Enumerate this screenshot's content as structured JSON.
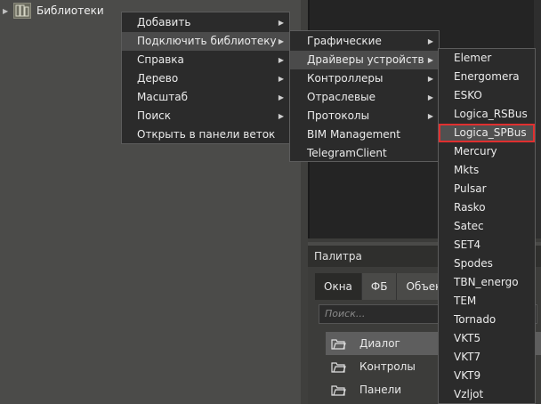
{
  "tree": {
    "root_label": "Библиотеки"
  },
  "palette": {
    "title": "Палитра",
    "tabs": [
      "Окна",
      "ФБ",
      "Объек"
    ],
    "search_placeholder": "Поиск...",
    "items": [
      "Диалог",
      "Контролы",
      "Панели"
    ]
  },
  "context_menu": {
    "items": [
      "Добавить",
      "Подключить библиотеку",
      "Справка",
      "Дерево",
      "Масштаб",
      "Поиск",
      "Открыть в панели веток"
    ]
  },
  "submenu_library": {
    "items": [
      "Графические",
      "Драйверы устройств",
      "Контроллеры",
      "Отраслевые",
      "Протоколы",
      "BIM Management",
      "TelegramClient"
    ]
  },
  "submenu_drivers": {
    "items": [
      "Elemer",
      "Energomera",
      "ESKO",
      "Logica_RSBus",
      "Logica_SPBus",
      "Mercury",
      "Mkts",
      "Pulsar",
      "Rasko",
      "Satec",
      "SET4",
      "Spodes",
      "TBN_energo",
      "TEM",
      "Tornado",
      "VKT5",
      "VKT7",
      "VKT9",
      "Vzljot"
    ],
    "highlighted": "Logica_SPBus"
  },
  "colors": {
    "highlight_border": "#e03030"
  }
}
